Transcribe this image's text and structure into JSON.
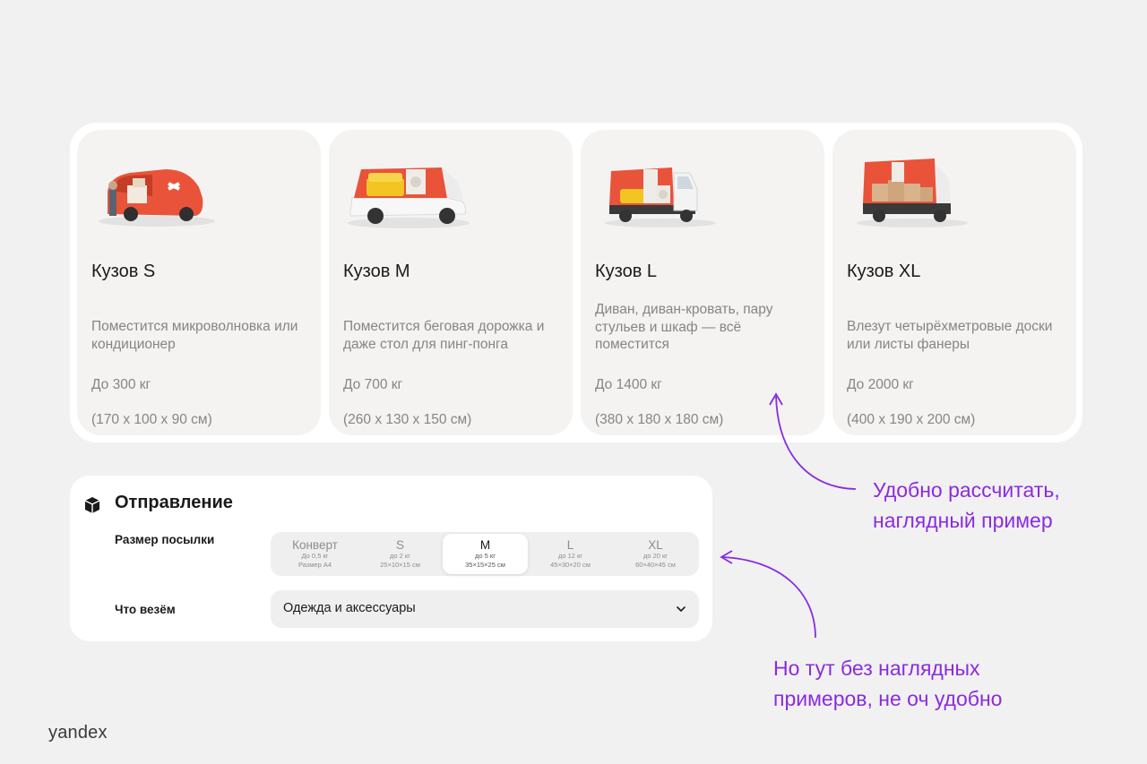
{
  "vehicles": [
    {
      "title": "Кузов S",
      "description": "Поместится микроволновка или кондиционер",
      "weight": "До 300 кг",
      "dimensions": "(170 х 100 х 90 см)",
      "icon": "compact-van-icon"
    },
    {
      "title": "Кузов M",
      "description": "Поместится беговая дорожка и даже стол для пинг-понга",
      "weight": "До 700 кг",
      "dimensions": "(260 х 130 х 150 см)",
      "icon": "pickup-van-icon"
    },
    {
      "title": "Кузов L",
      "description": "Диван, диван-кровать, пару стульев и шкаф — всё поместится",
      "weight": "До 1400 кг",
      "dimensions": "(380 х 180 х 180 см)",
      "icon": "flatbed-truck-icon"
    },
    {
      "title": "Кузов XL",
      "description": "Влезут четырёхметровые доски или листы фанеры",
      "weight": "До 2000 кг",
      "dimensions": "(400 х 190 х 200 см)",
      "icon": "large-truck-icon"
    }
  ],
  "form": {
    "title": "Отправление",
    "size_label": "Размер посылки",
    "sizes": [
      {
        "name": "Конверт",
        "line1": "До 0,5 кг",
        "line2": "Размер А4"
      },
      {
        "name": "S",
        "line1": "до 2 кг",
        "line2": "25×10×15 см"
      },
      {
        "name": "M",
        "line1": "до 5 кг",
        "line2": "35×15×25 см"
      },
      {
        "name": "L",
        "line1": "до 12 кг",
        "line2": "45×30×20 см"
      },
      {
        "name": "XL",
        "line1": "до 20 кг",
        "line2": "60×40×45 см"
      }
    ],
    "selected_size": "M",
    "cargo_label": "Что везём",
    "cargo_value": "Одежда и аксессуары"
  },
  "annotations": {
    "top": [
      "Удобно рассчитать,",
      "наглядный пример"
    ],
    "bottom": [
      "Но тут без наглядных",
      "примеров, не оч удобно"
    ]
  },
  "brand": "yandex",
  "colors": {
    "accent_orange": "#e9533a",
    "annotation_purple": "#8a2be2",
    "card_background": "#f4f3f2",
    "page_background": "#f1f1f1"
  }
}
